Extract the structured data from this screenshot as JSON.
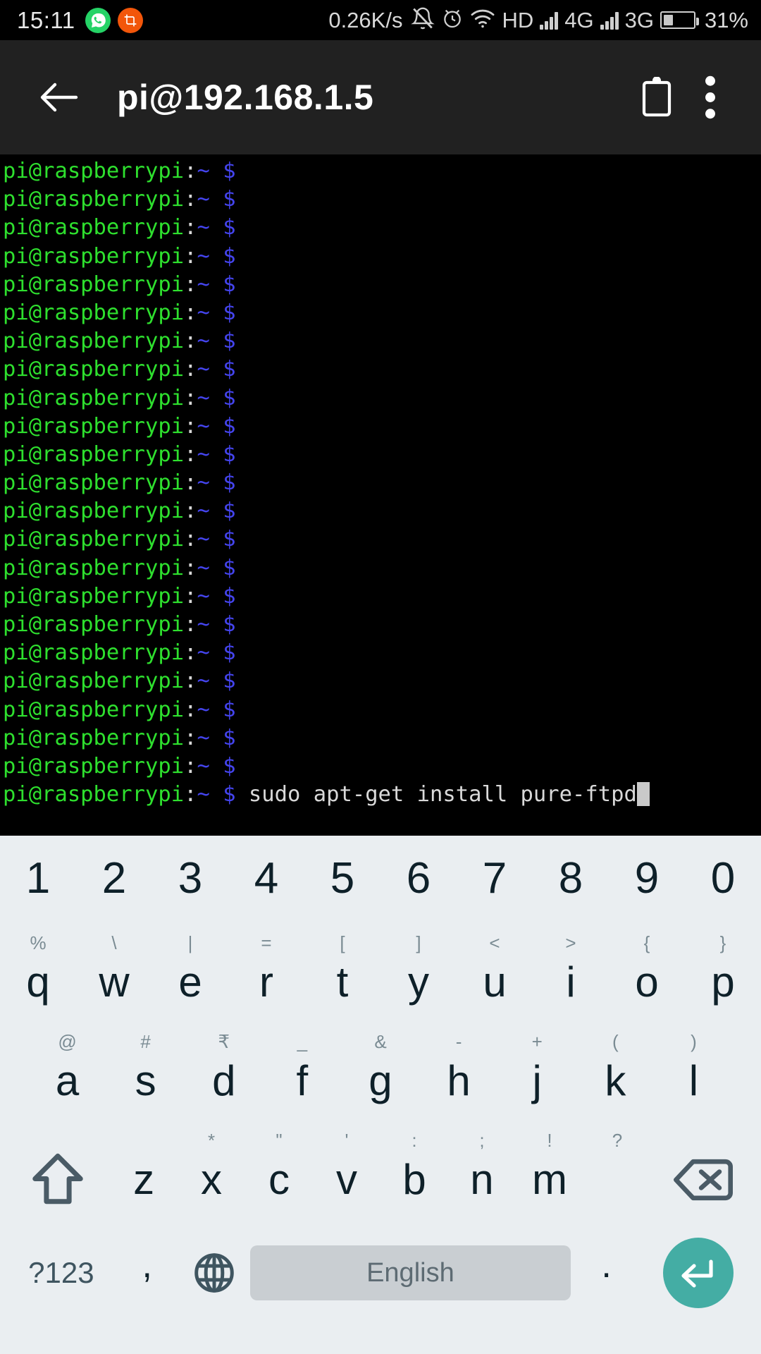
{
  "status_bar": {
    "time": "15:11",
    "app_icons": [
      {
        "name": "whatsapp-icon",
        "color": "#25D366"
      },
      {
        "name": "screenshot-crop-icon",
        "color": "#F2560A"
      }
    ],
    "network_speed": "0.26K/s",
    "indicators": [
      {
        "name": "silent-mode-icon"
      },
      {
        "name": "alarm-clock-icon"
      },
      {
        "name": "wifi-icon"
      },
      {
        "name": "hd-call-icon",
        "label": "HD"
      },
      {
        "name": "sim1-signal-icon"
      },
      {
        "name": "sim1-network-type",
        "label": "4G"
      },
      {
        "name": "sim2-signal-icon"
      },
      {
        "name": "sim2-network-type",
        "label": "3G"
      }
    ],
    "battery_percent": "31%",
    "battery_level": 31
  },
  "app_bar": {
    "back_label": "back-arrow",
    "title": "pi@192.168.1.5",
    "paste_label": "paste-clipboard",
    "overflow_label": "more-options"
  },
  "terminal": {
    "background": "#000000",
    "prompt": {
      "user_host": "pi@raspberrypi",
      "colon": ":",
      "path": "~",
      "symbol": "$",
      "colors": {
        "user_host": "#2ee02e",
        "colon": "#d8d8d8",
        "path": "#4444ee",
        "symbol": "#4444ee",
        "command": "#d9d9d9"
      }
    },
    "empty_prompt_count": 22,
    "current_command": "sudo apt-get install pure-ftpd",
    "cursor_visible": true
  },
  "keyboard": {
    "background": "#EAEEF1",
    "language": "English",
    "rows": {
      "numbers": [
        "1",
        "2",
        "3",
        "4",
        "5",
        "6",
        "7",
        "8",
        "9",
        "0"
      ],
      "top": [
        {
          "main": "q",
          "sub": "%"
        },
        {
          "main": "w",
          "sub": "\\"
        },
        {
          "main": "e",
          "sub": "|"
        },
        {
          "main": "r",
          "sub": "="
        },
        {
          "main": "t",
          "sub": "["
        },
        {
          "main": "y",
          "sub": "]"
        },
        {
          "main": "u",
          "sub": "<"
        },
        {
          "main": "i",
          "sub": ">"
        },
        {
          "main": "o",
          "sub": "{"
        },
        {
          "main": "p",
          "sub": "}"
        }
      ],
      "home": [
        {
          "main": "a",
          "sub": "@"
        },
        {
          "main": "s",
          "sub": "#"
        },
        {
          "main": "d",
          "sub": "₹"
        },
        {
          "main": "f",
          "sub": "_"
        },
        {
          "main": "g",
          "sub": "&"
        },
        {
          "main": "h",
          "sub": "-"
        },
        {
          "main": "j",
          "sub": "+"
        },
        {
          "main": "k",
          "sub": "("
        },
        {
          "main": "l",
          "sub": ")"
        }
      ],
      "bottom": [
        {
          "main": "z",
          "sub": ""
        },
        {
          "main": "x",
          "sub": "*"
        },
        {
          "main": "c",
          "sub": "\""
        },
        {
          "main": "v",
          "sub": "'"
        },
        {
          "main": "b",
          "sub": ":"
        },
        {
          "main": "n",
          "sub": ";"
        },
        {
          "main": "m",
          "sub": "!"
        }
      ],
      "bottom_extra_sub": "?"
    },
    "function_row": {
      "symbols_label": "?123",
      "comma_label": ",",
      "globe_label": "language-switch",
      "space_label": "English",
      "period_label": ".",
      "enter_label": "enter",
      "enter_color": "#44ADA4"
    },
    "shift_label": "shift",
    "backspace_label": "backspace"
  }
}
